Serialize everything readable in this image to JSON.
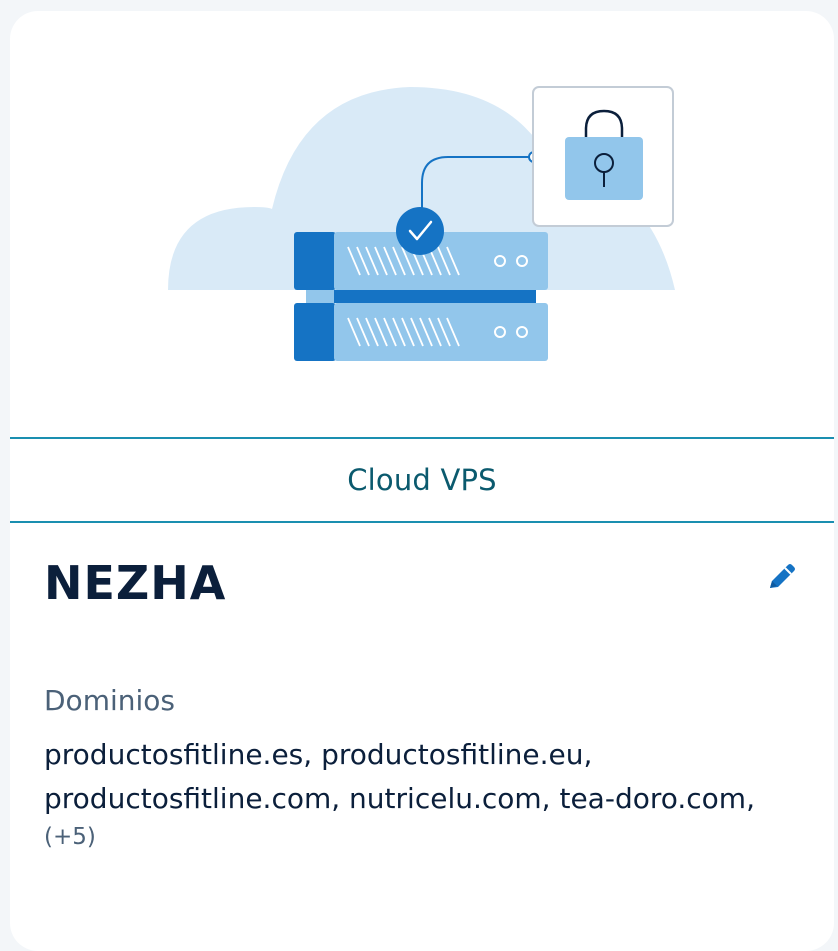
{
  "card": {
    "product_type": "Cloud VPS",
    "server_name": "NEZHA",
    "edit_icon": "pencil-icon",
    "domains_label": "Dominios",
    "domains_line_1": "productosfitline.es, productosfitline.eu,",
    "domains_line_2": "productosfitline.com, nutricelu.com, tea-doro.com,",
    "more_count": "(+5)"
  },
  "colors": {
    "accent": "#1573c4",
    "divider": "#1a8fb0",
    "title": "#0b1f3b",
    "muted": "#4b6178",
    "cloud": "#d9eaf7"
  }
}
